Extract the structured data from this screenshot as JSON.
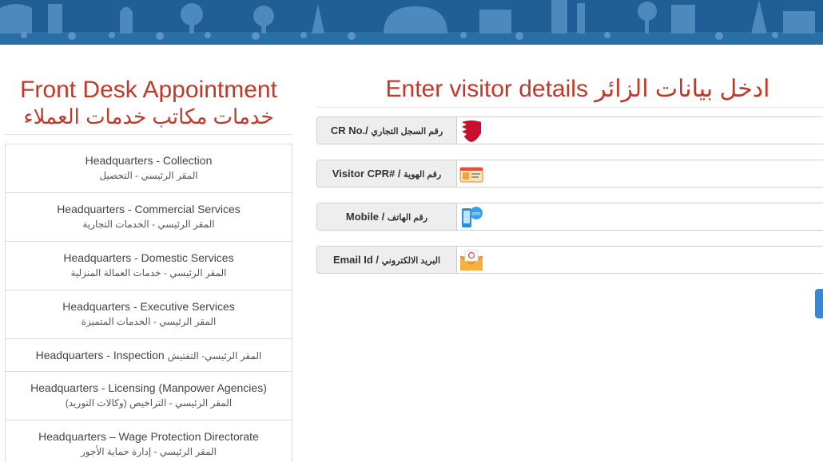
{
  "left": {
    "title": "Front Desk Appointment",
    "subtitle": "خدمات مكاتب خدمات العملاء",
    "offices": [
      {
        "en": "Headquarters - Collection",
        "ar": "المقر الرئيسي - التحصيل"
      },
      {
        "en": "Headquarters - Commercial Services",
        "ar": "المقر الرئيسي - الخدمات التجارية"
      },
      {
        "en": "Headquarters - Domestic Services",
        "ar": "المقر الرئيسي - خدمات العمالة المنزلية"
      },
      {
        "en": "Headquarters - Executive Services",
        "ar": "المقر الرئيسي - الخدمات المتميزة"
      },
      {
        "en": "Headquarters - Inspection",
        "ar": "المقر الرئيسي- التفتيش"
      },
      {
        "en": "Headquarters - Licensing (Manpower Agencies)",
        "ar": "المقر الرئيسي - التراخيص (وكالات التوريد)"
      },
      {
        "en": "Headquarters – Wage Protection Directorate",
        "ar": "المقر الرئيسي - إدارة حماية الأجور"
      }
    ]
  },
  "right": {
    "title": "Enter visitor details ادخل بيانات الزائر",
    "fields": [
      {
        "label_en": "CR No./",
        "label_ar": "رقم السجل التجاري",
        "icon": "bahrain-flag-icon",
        "value": ""
      },
      {
        "label_en": "Visitor CPR# /",
        "label_ar": "رقم الهوية",
        "icon": "id-card-icon",
        "value": ""
      },
      {
        "label_en": "Mobile /",
        "label_ar": "رقم الهاتف",
        "icon": "sms-phone-icon",
        "value": ""
      },
      {
        "label_en": "Email Id /",
        "label_ar": "البريد الالكتروني",
        "icon": "email-envelope-icon",
        "value": ""
      }
    ]
  },
  "colors": {
    "banner": "#1f5f96",
    "heading": "#c0392b",
    "button": "#3a86cf"
  }
}
